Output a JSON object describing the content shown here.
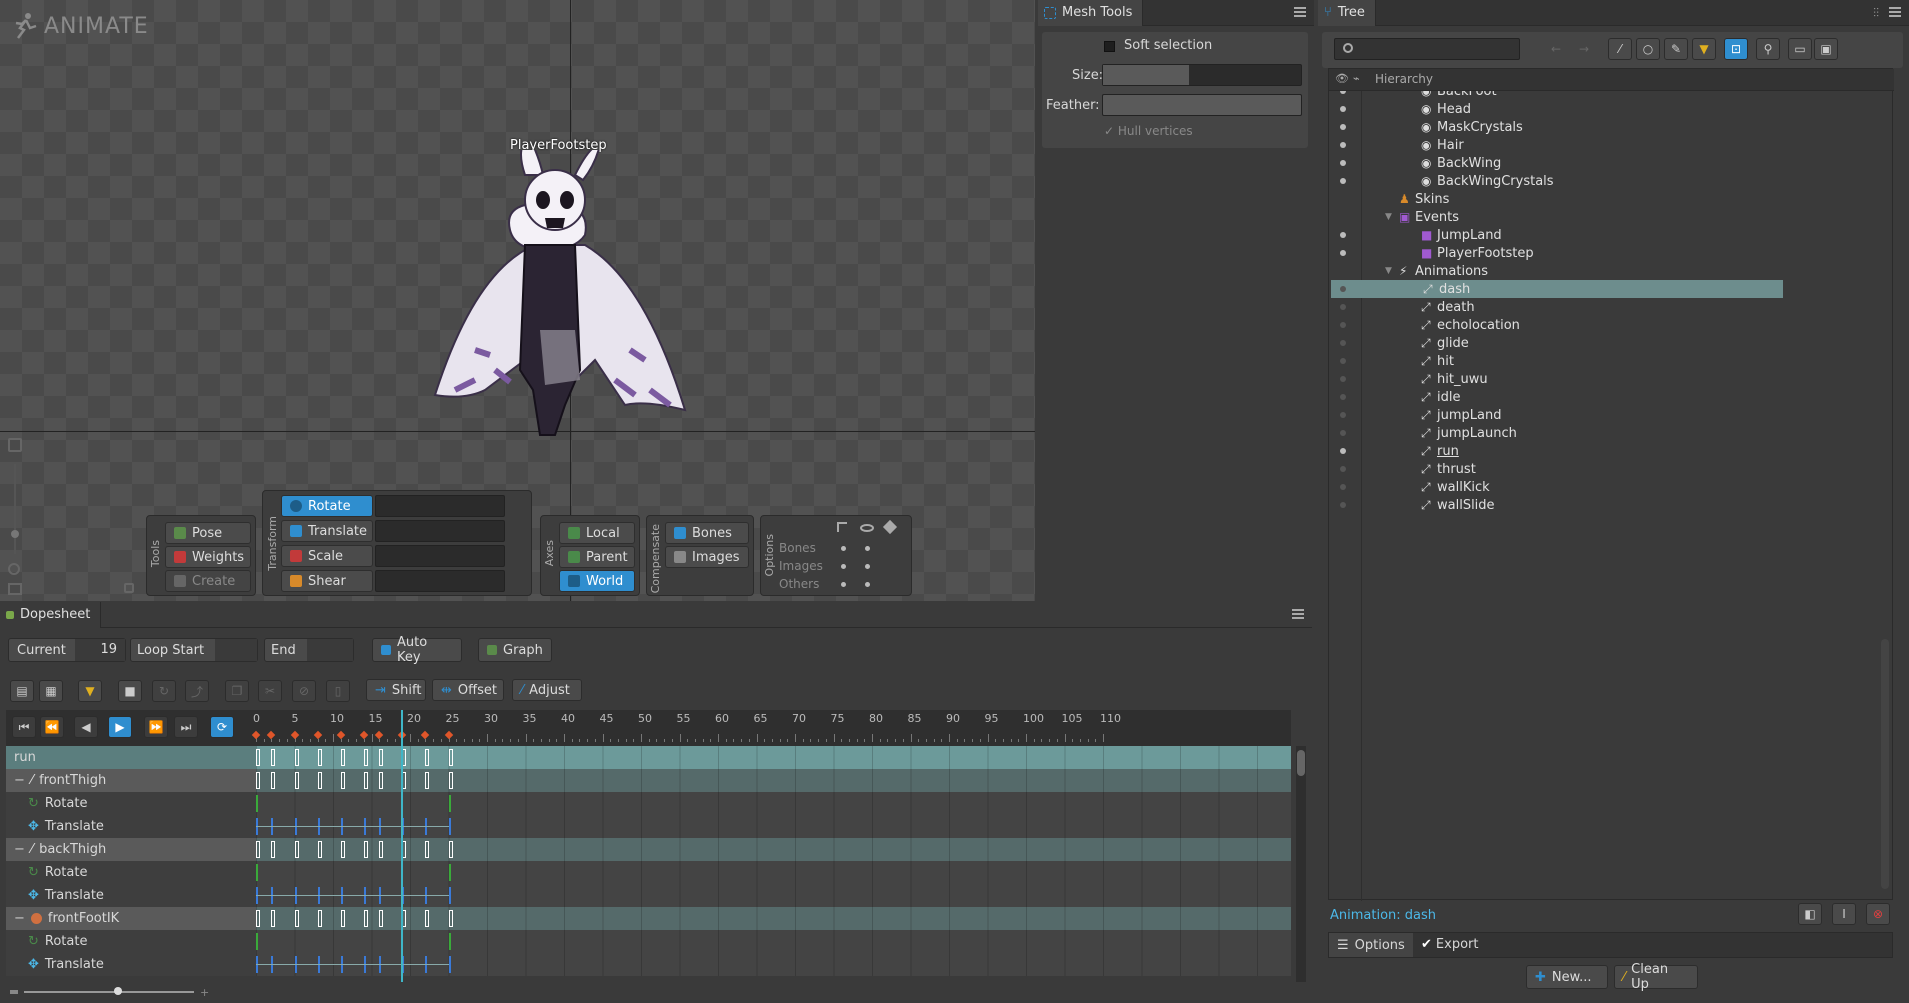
{
  "app": {
    "logo_text": "ANIMATE"
  },
  "viewport": {
    "event_label": "PlayerFootstep"
  },
  "tools": {
    "group_labels": {
      "tools": "Tools",
      "transform": "Transform",
      "axes": "Axes",
      "compensate": "Compensate",
      "options": "Options"
    },
    "pose": "Pose",
    "weights": "Weights",
    "create": "Create",
    "rotate": "Rotate",
    "translate": "Translate",
    "scale": "Scale",
    "shear": "Shear",
    "local": "Local",
    "parent": "Parent",
    "world": "World",
    "bones": "Bones",
    "images": "Images",
    "options_rows": [
      "Bones",
      "Images",
      "Others"
    ]
  },
  "mesh_tools": {
    "title": "Mesh Tools",
    "soft_selection": "Soft selection",
    "size_label": "Size:",
    "feather_label": "Feather:",
    "hull_vertices": "Hull vertices"
  },
  "tree": {
    "title": "Tree",
    "header": "Hierarchy",
    "items": [
      {
        "label": "BackFoot",
        "kind": "slot",
        "dot": "on"
      },
      {
        "label": "Head",
        "kind": "slot",
        "dot": "on"
      },
      {
        "label": "MaskCrystals",
        "kind": "slot",
        "dot": "on"
      },
      {
        "label": "Hair",
        "kind": "slot",
        "dot": "on"
      },
      {
        "label": "BackWing",
        "kind": "slot",
        "dot": "on"
      },
      {
        "label": "BackWingCrystals",
        "kind": "slot",
        "dot": "on"
      },
      {
        "label": "Skins",
        "kind": "skins",
        "dot": "none"
      },
      {
        "label": "Events",
        "kind": "events",
        "dot": "none"
      },
      {
        "label": "JumpLand",
        "kind": "event",
        "dot": "on"
      },
      {
        "label": "PlayerFootstep",
        "kind": "event",
        "dot": "on"
      },
      {
        "label": "Animations",
        "kind": "animations",
        "dot": "none"
      },
      {
        "label": "dash",
        "kind": "anim",
        "dot": "dim",
        "selected": true
      },
      {
        "label": "death",
        "kind": "anim",
        "dot": "dim"
      },
      {
        "label": "echolocation",
        "kind": "anim",
        "dot": "dim"
      },
      {
        "label": "glide",
        "kind": "anim",
        "dot": "dim"
      },
      {
        "label": "hit",
        "kind": "anim",
        "dot": "dim"
      },
      {
        "label": "hit_uwu",
        "kind": "anim",
        "dot": "dim"
      },
      {
        "label": "idle",
        "kind": "anim",
        "dot": "dim"
      },
      {
        "label": "jumpLand",
        "kind": "anim",
        "dot": "dim"
      },
      {
        "label": "jumpLaunch",
        "kind": "anim",
        "dot": "dim"
      },
      {
        "label": "run",
        "kind": "anim",
        "dot": "on",
        "underline": true
      },
      {
        "label": "thrust",
        "kind": "anim",
        "dot": "dim"
      },
      {
        "label": "wallKick",
        "kind": "anim",
        "dot": "dim"
      },
      {
        "label": "wallSlide",
        "kind": "anim",
        "dot": "dim"
      }
    ],
    "status": "Animation: dash",
    "options_tab": "Options",
    "export_label": "Export",
    "new_button": "New...",
    "cleanup_button": "Clean Up"
  },
  "dopesheet": {
    "title": "Dopesheet",
    "current_label": "Current",
    "current_value": "19",
    "loop_start_label": "Loop Start",
    "end_label": "End",
    "auto_key": "Auto Key",
    "graph": "Graph",
    "shift": "Shift",
    "offset": "Offset",
    "adjust": "Adjust",
    "ruler": [
      "0",
      "5",
      "10",
      "15",
      "20",
      "25",
      "30",
      "35",
      "40",
      "45",
      "50",
      "55",
      "60",
      "65",
      "70",
      "75",
      "80",
      "85",
      "90",
      "95",
      "100",
      "105",
      "110"
    ],
    "current_frame": 19,
    "rows": [
      {
        "label": "run",
        "type": "anim"
      },
      {
        "label": "frontThigh",
        "type": "bone"
      },
      {
        "label": "Rotate",
        "type": "rotate"
      },
      {
        "label": "Translate",
        "type": "translate"
      },
      {
        "label": "backThigh",
        "type": "bone"
      },
      {
        "label": "Rotate",
        "type": "rotate"
      },
      {
        "label": "Translate",
        "type": "translate"
      },
      {
        "label": "frontFootIK",
        "type": "ik"
      },
      {
        "label": "Rotate",
        "type": "rotate"
      },
      {
        "label": "Translate",
        "type": "translate"
      }
    ],
    "keys": [
      0,
      2,
      5,
      8,
      11,
      14,
      16,
      19,
      22,
      25
    ]
  },
  "colors": {
    "accent": "#2f8ecf",
    "selection": "#6d8d8d",
    "key_orange": "#e0562a",
    "playhead": "#3fb6c8"
  }
}
